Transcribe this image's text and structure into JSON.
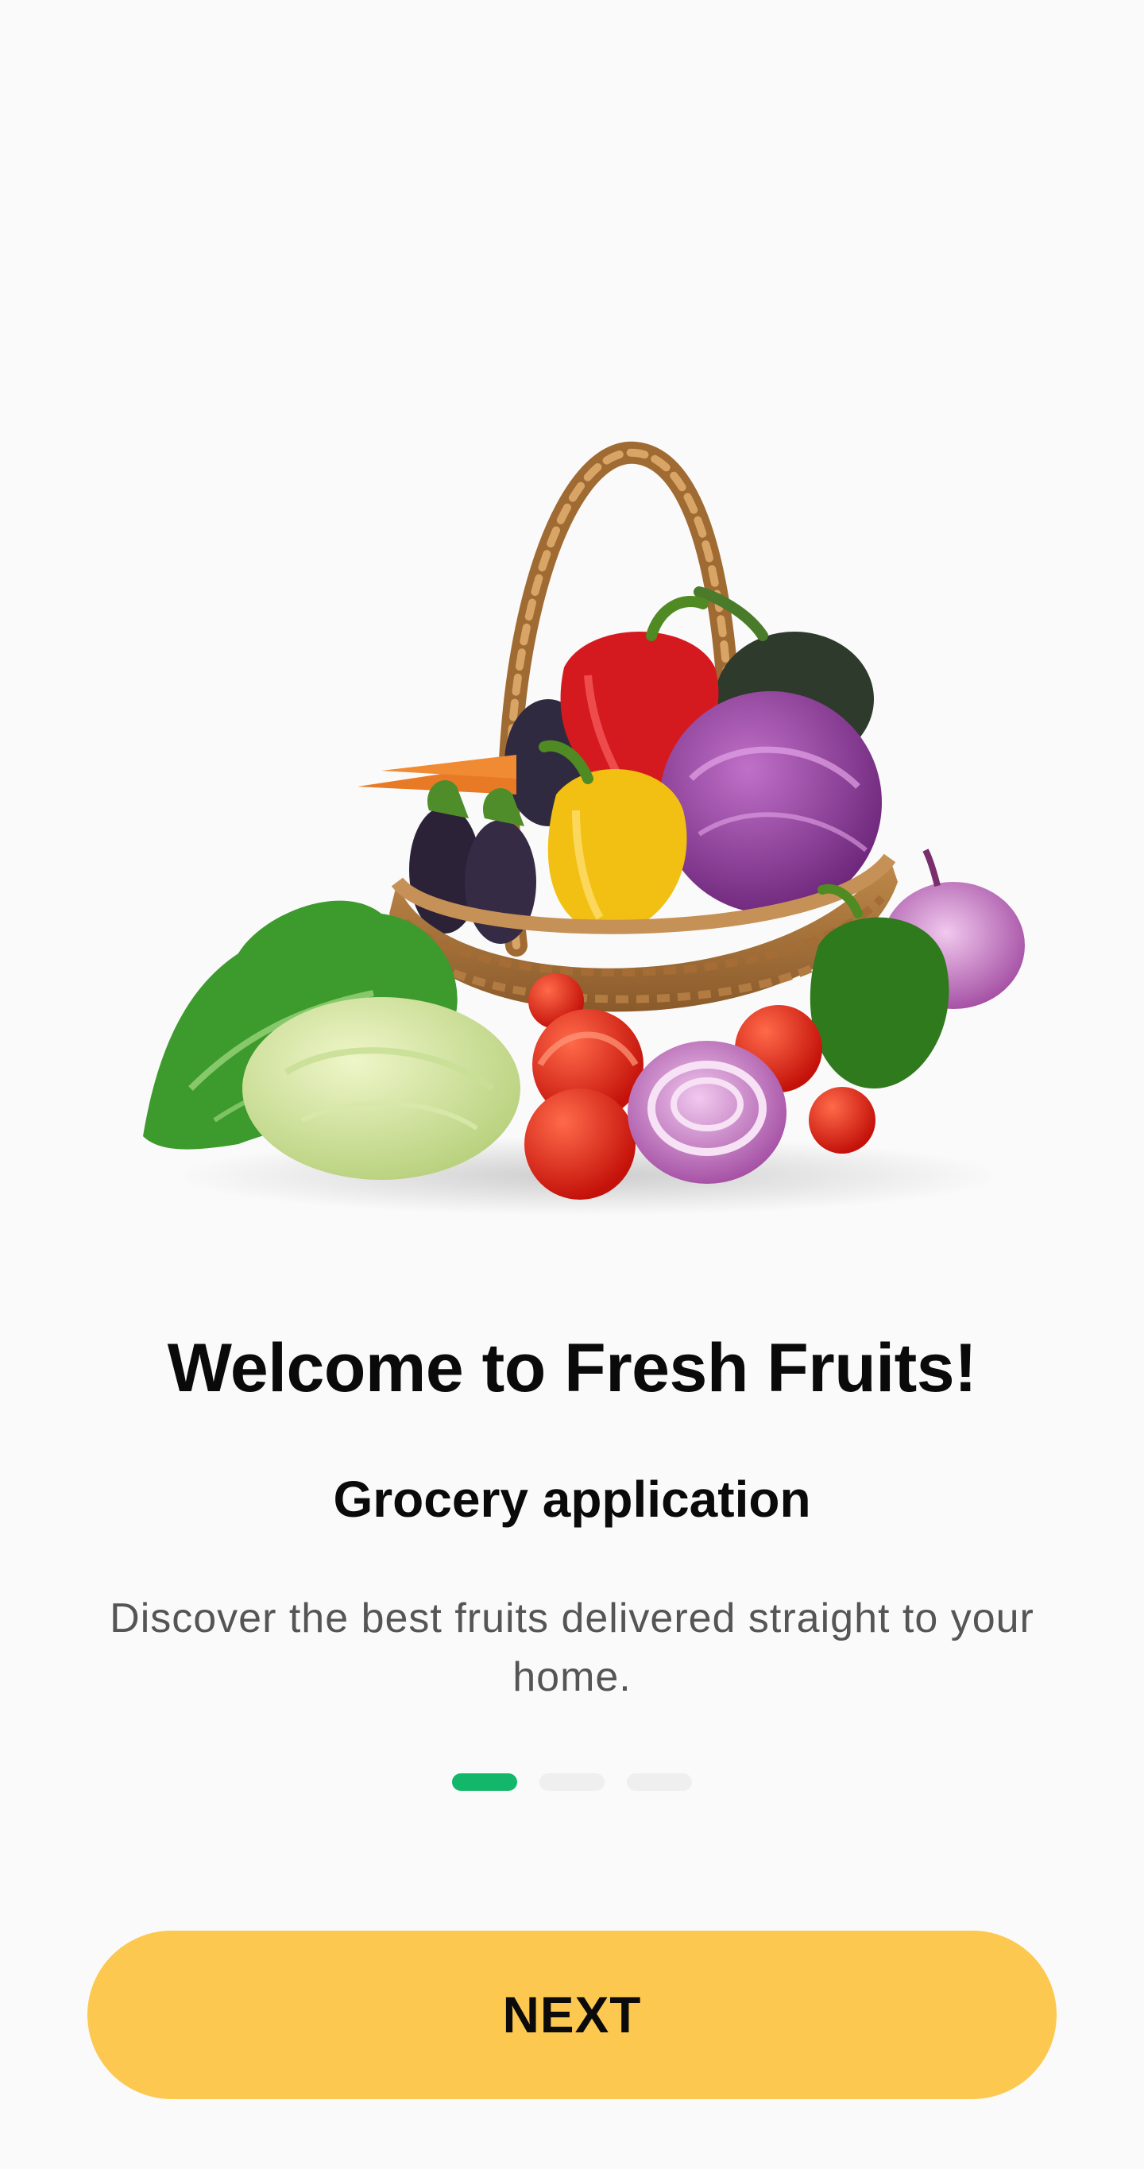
{
  "onboarding": {
    "title": "Welcome to Fresh Fruits!",
    "subtitle": "Grocery application",
    "description": "Discover the best fruits delivered straight to your home.",
    "pagination": {
      "current": 1,
      "total": 3
    },
    "next_label": "NEXT",
    "illustration": "vegetable-basket-image"
  },
  "colors": {
    "background": "#fafafa",
    "accent_green": "#12b76a",
    "button_yellow": "#fdc84f",
    "dot_inactive": "#efefef"
  }
}
